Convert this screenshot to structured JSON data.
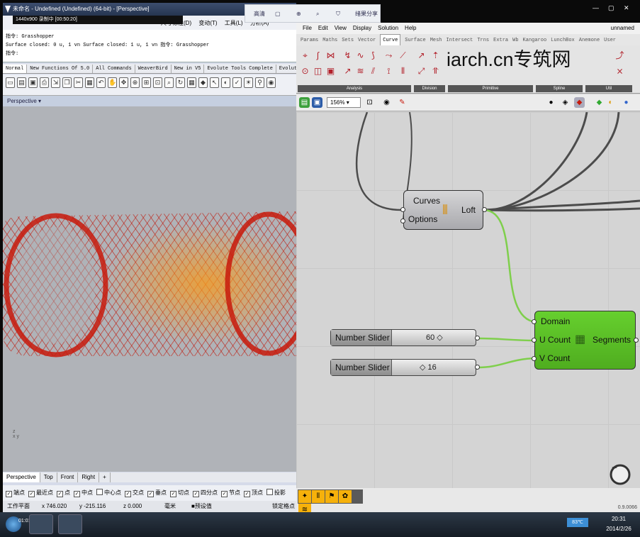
{
  "rhino": {
    "title": "未命名 - Undefined (Undefined) (64-bit) - [Perspective]",
    "recorder": "1440x900  录制中 [00:50:20]",
    "menu_after": [
      "尺寸标注(D)",
      "变动(T)",
      "工具(L)",
      "分析(A)"
    ],
    "cmd_lines": [
      "指令: Grasshopper",
      "Surface closed: 0 u, 1 vn  Surface closed: 1 u, 1 vn  指令: Grasshopper",
      "指令:"
    ],
    "tabs": [
      "Normal",
      "New Functions Of 5.0",
      "All Commands",
      "WeaverBird",
      "New in V5",
      "Evolute Tools Complete",
      "EvoluteTo"
    ],
    "viewport_label": "Perspective",
    "axis_label": "z\nx y",
    "view_tabs": [
      "Perspective",
      "Top",
      "Front",
      "Right",
      "+"
    ],
    "osnaps": [
      {
        "label": "端点",
        "checked": true
      },
      {
        "label": "最近点",
        "checked": true
      },
      {
        "label": "点",
        "checked": true
      },
      {
        "label": "中点",
        "checked": true
      },
      {
        "label": "中心点",
        "checked": false
      },
      {
        "label": "交点",
        "checked": true
      },
      {
        "label": "垂点",
        "checked": true
      },
      {
        "label": "切点",
        "checked": true
      },
      {
        "label": "四分点",
        "checked": true
      },
      {
        "label": "节点",
        "checked": true
      },
      {
        "label": "顶点",
        "checked": true
      },
      {
        "label": "投影",
        "checked": false
      }
    ],
    "status": {
      "plane": "工作平面",
      "x": "x 746.020",
      "y": "y -215.116",
      "z": "z 0.000",
      "unit": "毫米",
      "layer": "预设值",
      "lock": "锁定格点"
    }
  },
  "float_bar": {
    "a": "高清",
    "b": "绪果分享"
  },
  "grasshopper": {
    "menu": [
      "File",
      "Edit",
      "View",
      "Display",
      "Solution",
      "Help"
    ],
    "doc": "unnamed",
    "tabs": [
      "Params",
      "Maths",
      "Sets",
      "Vector",
      "Curve",
      "Surface",
      "Mesh",
      "Intersect",
      "Trns",
      "Extra",
      "Wb",
      "Kangaroo",
      "LunchBox",
      "Anemone",
      "User"
    ],
    "active_tab": "Curve",
    "groups": [
      "Analysis",
      "Division",
      "Primitive",
      "Spline",
      "Util"
    ],
    "zoom": "156%",
    "loft": {
      "in1": "Curves",
      "in2": "Options",
      "out": "Loft"
    },
    "slider1": {
      "label": "Number Slider",
      "value": "60 ◇"
    },
    "slider2": {
      "label": "Number Slider",
      "value": "◇ 16"
    },
    "segments": {
      "in1": "Domain",
      "in2": "U Count",
      "in3": "V Count",
      "out": "Segments"
    },
    "version": "0.9.0066"
  },
  "watermark": "iarch.cn专筑网",
  "taskbar": {
    "rec": "01:01:42",
    "indicator": "83℃",
    "time": "20:31",
    "date": "2014/2/26"
  },
  "colors": {
    "mesh": "#c81a0c",
    "gh_green": "#5dbf28",
    "gh_grey": "#b9b9bb"
  }
}
